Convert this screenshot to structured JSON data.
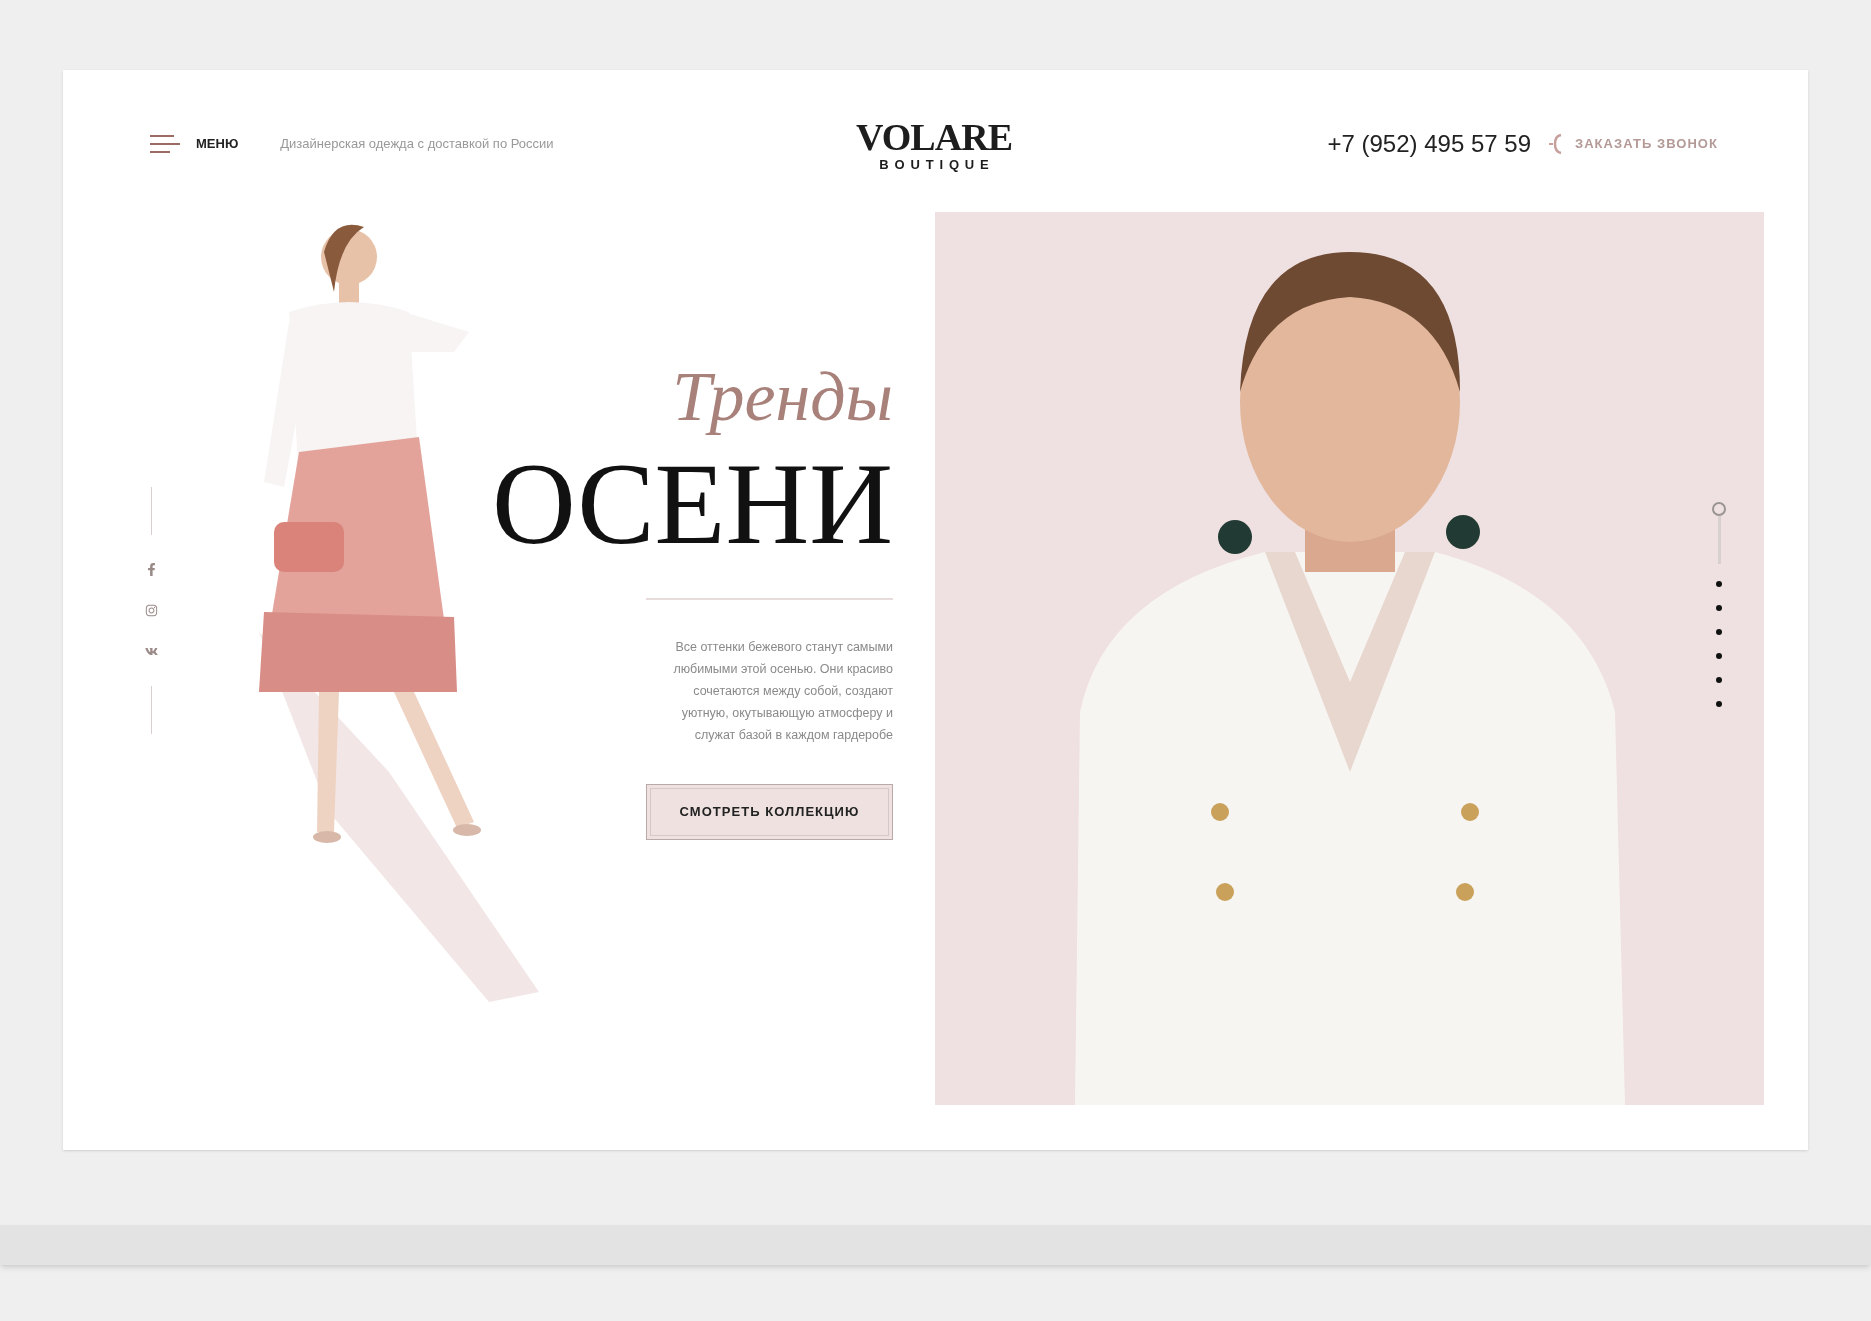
{
  "header": {
    "menu_label": "МЕНЮ",
    "tagline": "Дизайнерская одежда с доставкой по России",
    "logo": {
      "name": "VOLARE",
      "subtitle": "BOUTIQUE"
    },
    "phone": "+7 (952) 495 57 59",
    "callback": "ЗАКАЗАТЬ ЗВОНОК"
  },
  "social": [
    {
      "kind": "facebook"
    },
    {
      "kind": "instagram"
    },
    {
      "kind": "vk"
    }
  ],
  "hero": {
    "title_script": "Тренды",
    "title": "ОСЕНИ",
    "description": "Все оттенки бежевого станут самыми\nлюбимыми этой осенью. Они красиво\nсочетаются между собой, создают\nуютную, окутывающую атмосферу и\nслужат базой в каждом гардеробе",
    "button": "СМОТРЕТЬ КОЛЛЕКЦИЮ"
  },
  "slides": [
    {
      "selected": true
    },
    {
      "selected": false
    },
    {
      "selected": false
    },
    {
      "selected": false
    },
    {
      "selected": false
    },
    {
      "selected": false
    },
    {
      "selected": false
    }
  ]
}
